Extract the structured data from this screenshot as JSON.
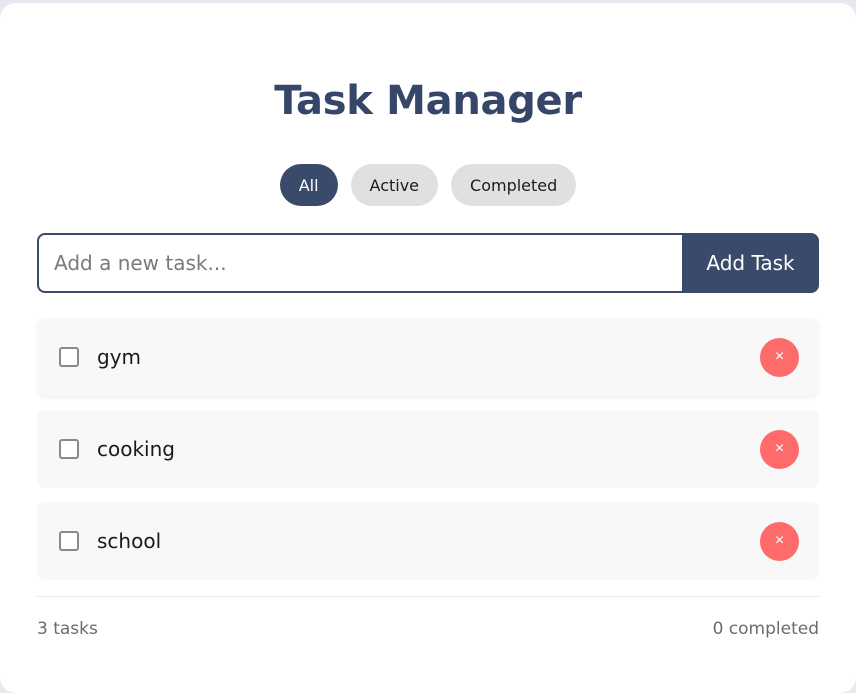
{
  "app": {
    "title": "Task Manager"
  },
  "filters": [
    {
      "label": "All",
      "active": true
    },
    {
      "label": "Active",
      "active": false
    },
    {
      "label": "Completed",
      "active": false
    }
  ],
  "add_task": {
    "placeholder": "Add a new task...",
    "value": "",
    "button_label": "Add Task"
  },
  "tasks": [
    {
      "label": "gym",
      "completed": false,
      "delete_glyph": "×"
    },
    {
      "label": "cooking",
      "completed": false,
      "delete_glyph": "×"
    },
    {
      "label": "school",
      "completed": false,
      "delete_glyph": "×"
    }
  ],
  "footer": {
    "task_count": "3 tasks",
    "completed_count": "0 completed"
  },
  "colors": {
    "primary": "#3a4a6b",
    "title": "#354668",
    "danger": "#ff6b6b",
    "filter_inactive": "#e0e0e0",
    "task_bg": "#f8f8f8"
  },
  "icons": {
    "delete": "close-icon",
    "checkbox": "checkbox-unchecked-icon"
  }
}
